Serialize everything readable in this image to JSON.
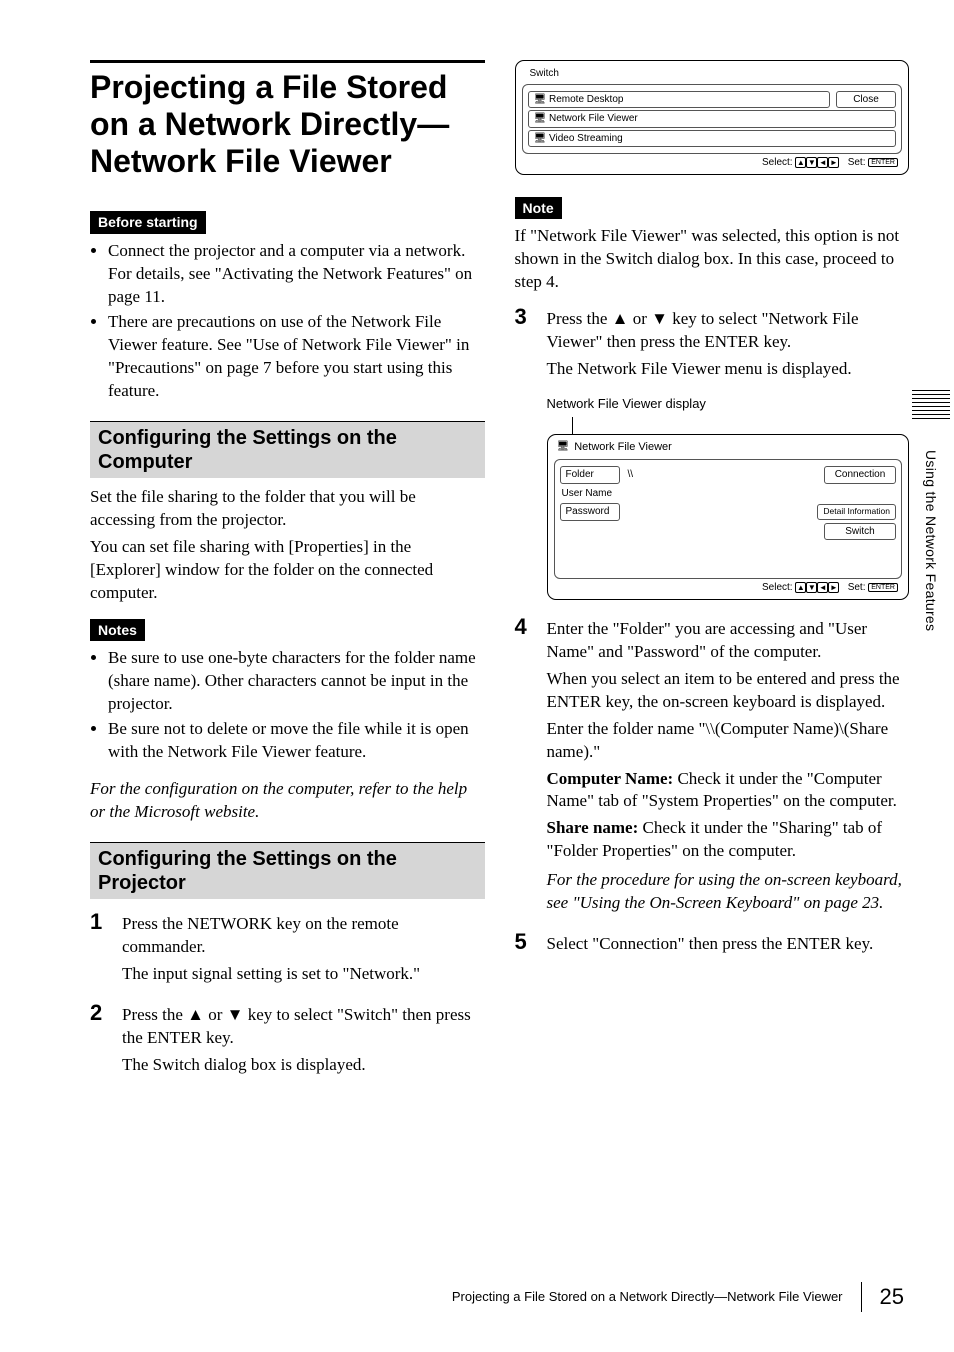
{
  "title": "Projecting a File Stored on a Network Directly—Network File Viewer",
  "before_starting": {
    "tag": "Before starting",
    "items": [
      "Connect the projector and a computer via a network. For details, see \"Activating the Network Features\" on page 11.",
      "There are precautions on use of the Network File Viewer feature. See \"Use of Network File Viewer\" in \"Precautions\" on page 7 before you start using this feature."
    ]
  },
  "sec1": {
    "heading": "Configuring the Settings on the Computer",
    "p1": "Set the file sharing to the folder that you will be accessing from the projector.",
    "p2": "You can set file sharing with [Properties] in the [Explorer] window for the folder on the connected computer."
  },
  "notes": {
    "tag": "Notes",
    "items": [
      "Be sure to use one-byte characters for the folder name (share name). Other characters cannot be input in the projector.",
      "Be sure not to delete or move the file while it is open with the Network File Viewer feature."
    ],
    "footer_italic": "For the configuration on the computer, refer to the help or the Microsoft website."
  },
  "sec2": {
    "heading": "Configuring the Settings on the Projector",
    "steps": {
      "s1": {
        "num": "1",
        "lead": "Press the NETWORK key on the remote commander.",
        "after": "The input signal setting is set to \"Network.\""
      },
      "s2": {
        "num": "2",
        "lead": "Press the ▲ or ▼ key to select \"Switch\" then press the ENTER key.",
        "after": "The Switch dialog box is displayed."
      }
    }
  },
  "switch_dialog": {
    "title": "Switch",
    "rows": {
      "r1": "Remote Desktop",
      "r2": "Network File Viewer",
      "r3": "Video Streaming"
    },
    "close": "Close",
    "footer_select": "Select:",
    "footer_set": "Set:",
    "footer_enter": "ENTER"
  },
  "note2": {
    "tag": "Note",
    "text": "If \"Network File Viewer\" was selected, this option is not shown in the Switch dialog box. In this case, proceed to step 4."
  },
  "s3": {
    "num": "3",
    "lead": "Press the ▲ or ▼ key to select \"Network File Viewer\" then press the ENTER key.",
    "after": "The Network File Viewer menu is displayed.",
    "caption": "Network File Viewer display"
  },
  "nfv_dialog": {
    "title": "Network File Viewer",
    "folder_label": "Folder",
    "folder_value": "\\\\",
    "user_label": "User Name",
    "pass_label": "Password",
    "btn_conn": "Connection",
    "btn_detail": "Detail Information",
    "btn_switch": "Switch",
    "footer_select": "Select:",
    "footer_set": "Set:",
    "footer_enter": "ENTER"
  },
  "s4": {
    "num": "4",
    "lead": "Enter the \"Folder\" you are accessing and \"User Name\" and \"Password\" of the computer.",
    "p2": "When you select an item to be entered and press the ENTER key, the on-screen keyboard is displayed.",
    "p3": "Enter the folder name \"\\\\(Computer Name)\\(Share name).\"",
    "cn_label": "Computer Name:",
    "cn_text": " Check it under the \"Computer Name\" tab of \"System Properties\" on the computer.",
    "sn_label": "Share name:",
    "sn_text": " Check it under the \"Sharing\" tab of \"Folder Properties\" on the computer.",
    "italic": "For the procedure for using the on-screen keyboard, see \"Using the On-Screen Keyboard\" on page 23."
  },
  "s5": {
    "num": "5",
    "lead": "Select \"Connection\" then press the ENTER key."
  },
  "side_tab": "Using the Network Features",
  "footer": {
    "title": "Projecting a File Stored on a Network Directly—Network File Viewer",
    "page": "25"
  }
}
